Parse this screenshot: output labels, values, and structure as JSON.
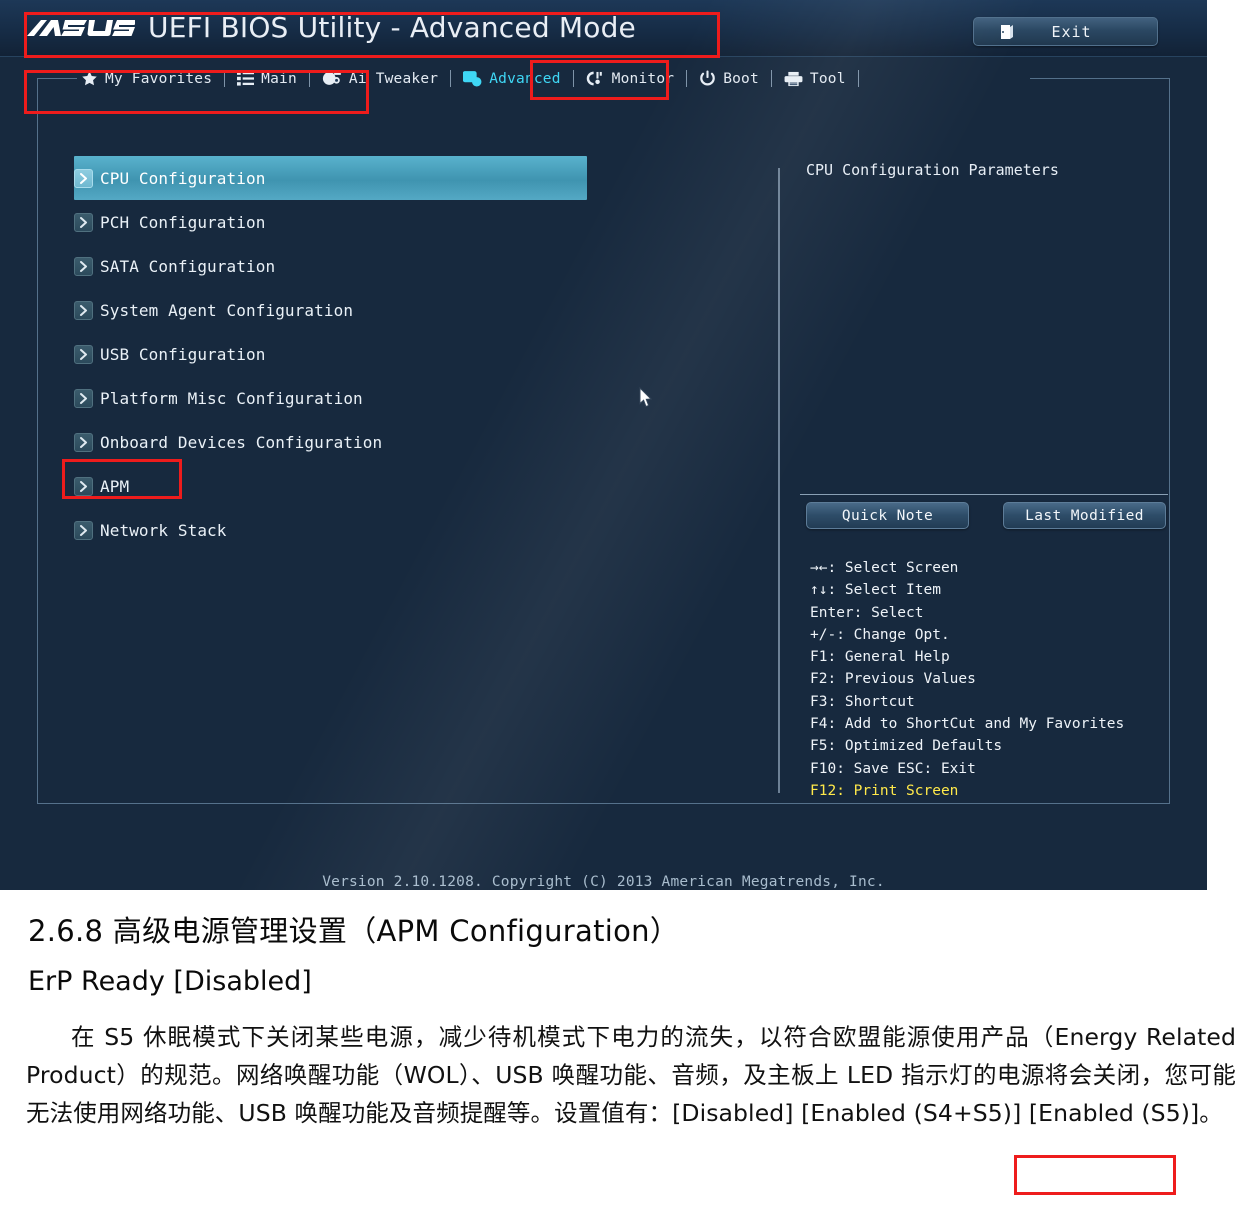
{
  "bios": {
    "brand": "ASUS",
    "title": "UEFI BIOS Utility - Advanced Mode",
    "exit_button": "Exit",
    "exit_icon": "exit-door-icon",
    "tabs": [
      {
        "label": "My Favorites",
        "icon": "star-icon",
        "active": false
      },
      {
        "label": "Main",
        "icon": "list-icon",
        "active": false
      },
      {
        "label": "Ai Tweaker",
        "icon": "tweaker-icon",
        "active": false
      },
      {
        "label": "Advanced",
        "icon": "advanced-gear-icon",
        "active": true
      },
      {
        "label": "Monitor",
        "icon": "monitor-icon",
        "active": false
      },
      {
        "label": "Boot",
        "icon": "power-icon",
        "active": false
      },
      {
        "label": "Tool",
        "icon": "tool-printer-icon",
        "active": false
      }
    ],
    "menu_items": [
      {
        "label": "CPU Configuration",
        "selected": true
      },
      {
        "label": "PCH Configuration",
        "selected": false
      },
      {
        "label": "SATA Configuration",
        "selected": false
      },
      {
        "label": "System Agent Configuration",
        "selected": false
      },
      {
        "label": "USB Configuration",
        "selected": false
      },
      {
        "label": "Platform Misc Configuration",
        "selected": false
      },
      {
        "label": "Onboard Devices Configuration",
        "selected": false
      },
      {
        "label": "APM",
        "selected": false
      },
      {
        "label": "Network Stack",
        "selected": false
      }
    ],
    "help": {
      "description": "CPU Configuration Parameters",
      "quick_note_button": "Quick Note",
      "last_modified_button": "Last Modified",
      "key_hints": [
        "→←: Select Screen",
        "↑↓: Select Item",
        "Enter: Select",
        "+/-: Change Opt.",
        "F1: General Help",
        "F2: Previous Values",
        "F3: Shortcut",
        "F4: Add to ShortCut and My Favorites",
        "F5: Optimized Defaults",
        "F10: Save  ESC: Exit"
      ],
      "key_hint_highlight": "F12: Print Screen"
    },
    "version_line": "Version 2.10.1208. Copyright (C) 2013 American Megatrends, Inc.",
    "colors": {
      "background": "#17293e",
      "selected_row": "#49a0bc",
      "active_tab": "#3fd7f5",
      "highlight_text": "#ffe94a",
      "annotation_red": "#ee1c1c"
    }
  },
  "document": {
    "heading": "2.6.8 高级电源管理设置（APM Configuration）",
    "subheading": "ErP Ready [Disabled]",
    "body": "在 S5 休眠模式下关闭某些电源，减少待机模式下电力的流失，以符合欧盟能源使用产品（Energy Related Product）的规范。网络唤醒功能（WOL）、USB 唤醒功能、音频，及主板上 LED 指示灯的电源将会关闭，您可能无法使用网络功能、USB 唤醒功能及音频提醒等。设置值有：[Disabled] [Enabled (S4+S5)] [Enabled (S5)]。",
    "options": [
      "[Disabled]",
      "[Enabled (S4+S5)]",
      "[Enabled (S5)]"
    ]
  }
}
